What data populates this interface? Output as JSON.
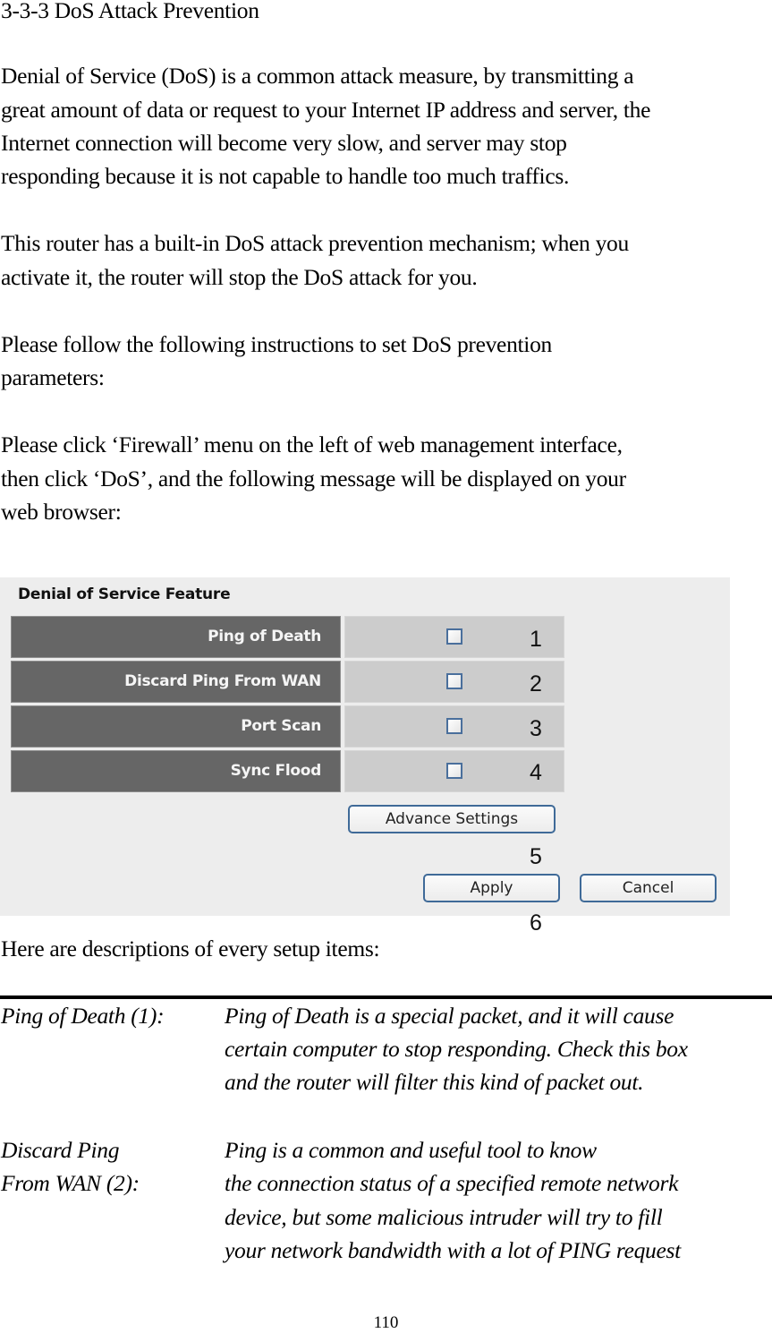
{
  "heading": "3-3-3 DoS Attack Prevention",
  "paragraphs": {
    "intro": [
      "Denial of Service (DoS) is a common attack measure, by transmitting a",
      "great amount of data or request to your Internet IP address and server, the",
      "Internet connection will become very slow, and server may stop",
      "responding because it is not capable to handle too much traffics."
    ],
    "builtin": [
      "This router has a built-in DoS attack prevention mechanism; when you",
      "activate it, the router will stop the DoS attack for you."
    ],
    "follow": [
      "Please follow the following instructions to set DoS prevention",
      "parameters:"
    ],
    "click": [
      "Please click ‘Firewall’ menu on the left of web management interface,",
      "then click ‘DoS’, and the following message will be displayed on your",
      "web browser:"
    ],
    "descriptions_intro": "Here are descriptions of every setup items:"
  },
  "panel": {
    "title": "Denial of Service Feature",
    "rows": [
      {
        "label": "Ping of Death",
        "checked": false,
        "marker": "1"
      },
      {
        "label": "Discard Ping From WAN",
        "checked": false,
        "marker": "2"
      },
      {
        "label": "Port Scan",
        "checked": false,
        "marker": "3"
      },
      {
        "label": "Sync Flood",
        "checked": false,
        "marker": "4"
      }
    ],
    "advance_settings_label": "Advance Settings",
    "advance_marker": "5",
    "apply_label": "Apply",
    "cancel_label": "Cancel",
    "apply_marker": "6",
    "colors": {
      "panel_bg": "#ededed",
      "label_cell": "#666666",
      "value_cell": "#cccccc",
      "button_border": "#3f6a98"
    }
  },
  "definitions": [
    {
      "term": [
        "Ping of Death (1):"
      ],
      "desc": [
        "Ping of Death is a special packet, and it will cause",
        "certain computer to stop responding. Check this box",
        "and the router will filter this kind of packet out."
      ]
    },
    {
      "term": [
        "Discard Ping",
        "From WAN (2):"
      ],
      "desc": [
        "Ping is a common and useful tool to know",
        "the connection status of a specified remote network",
        "device, but some malicious intruder will try to fill",
        "your network bandwidth with a lot of PING request"
      ]
    }
  ],
  "page_number": "110"
}
